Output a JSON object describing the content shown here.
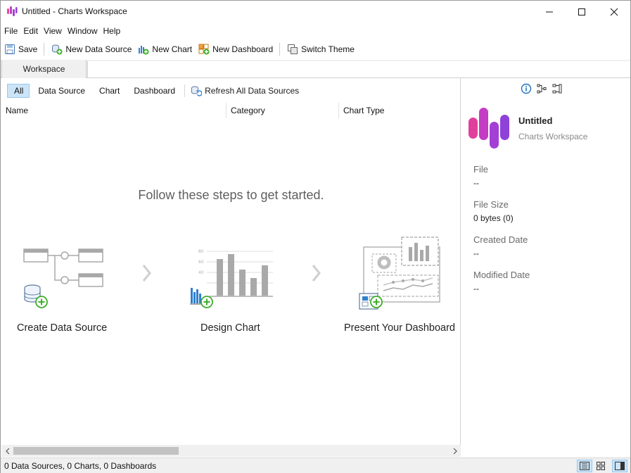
{
  "window": {
    "title": "Untitled - Charts Workspace",
    "accent": "#c13fc8"
  },
  "menu": [
    "File",
    "Edit",
    "View",
    "Window",
    "Help"
  ],
  "toolbar": {
    "save_label": "Save",
    "new_data_source_label": "New Data Source",
    "new_chart_label": "New Chart",
    "new_dashboard_label": "New Dashboard",
    "switch_theme_label": "Switch Theme"
  },
  "tabs": {
    "workspace_label": "Workspace"
  },
  "filters": {
    "items": [
      "All",
      "Data Source",
      "Chart",
      "Dashboard"
    ],
    "active": "All",
    "refresh_label": "Refresh All Data Sources"
  },
  "table": {
    "columns": [
      "Name",
      "Category",
      "Chart Type"
    ],
    "rows": []
  },
  "getting_started": {
    "title": "Follow these steps to get started.",
    "steps": [
      {
        "label": "Create Data Source",
        "icon": "data-source-illustration-icon"
      },
      {
        "label": "Design Chart",
        "icon": "chart-illustration-icon"
      },
      {
        "label": "Present Your Dashboard",
        "icon": "dashboard-illustration-icon"
      }
    ],
    "chart_ticks": [
      "80",
      "60",
      "40"
    ]
  },
  "info_panel": {
    "name": "Untitled",
    "subtitle": "Charts Workspace",
    "file_label": "File",
    "file_value": "--",
    "size_label": "File Size",
    "size_value": "0 bytes (0)",
    "created_label": "Created Date",
    "created_value": "--",
    "modified_label": "Modified Date",
    "modified_value": "--"
  },
  "status": {
    "text": "0 Data Sources, 0 Charts, 0 Dashboards"
  },
  "colors": {
    "green_plus": "#3fae2a",
    "selection": "#cce4f7",
    "logo_pink": "#e83e8c",
    "logo_purple": "#9b3fd1"
  }
}
